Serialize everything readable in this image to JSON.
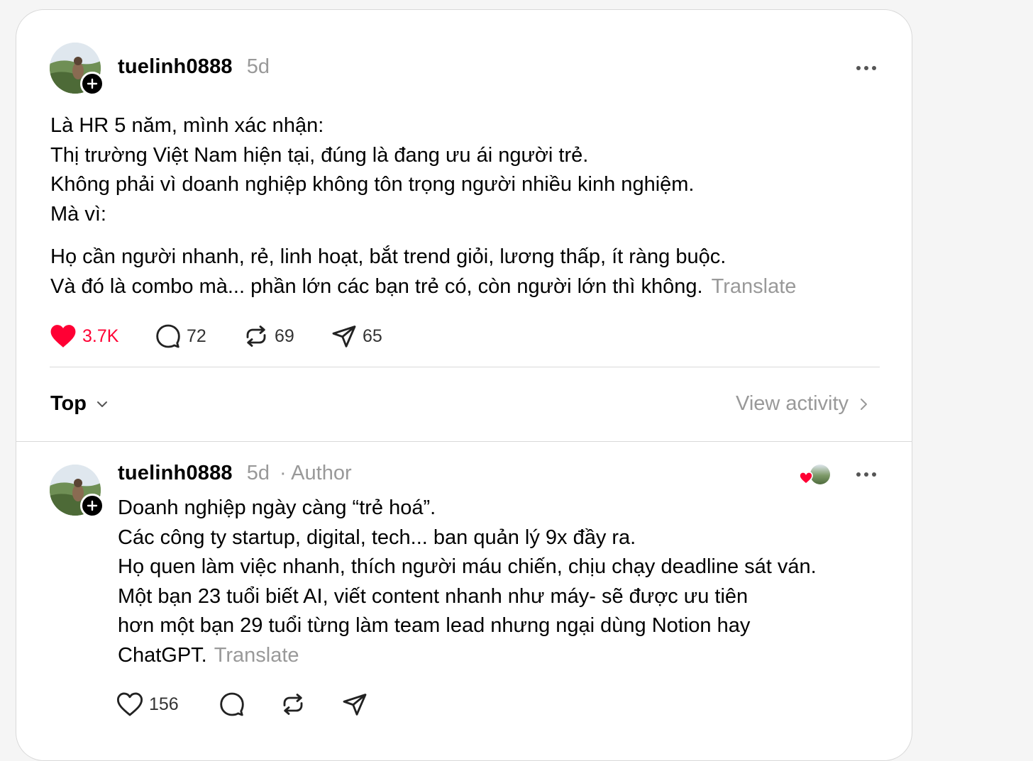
{
  "post": {
    "username": "tuelinh0888",
    "time": "5d",
    "lines": [
      "Là HR 5 năm, mình xác nhận:",
      "Thị trường Việt Nam hiện tại, đúng là đang ưu ái người trẻ.",
      "Không phải vì doanh nghiệp không tôn trọng người nhiều kinh nghiệm.",
      "Mà vì:",
      "Họ cần người nhanh, rẻ, linh hoạt, bắt trend giỏi, lương thấp, ít ràng buộc.",
      "Và đó là combo mà... phần lớn các bạn trẻ có, còn người lớn thì không."
    ],
    "translate": "Translate",
    "likes": "3.7K",
    "comments": "72",
    "reposts": "69",
    "shares": "65",
    "like_color": "#ff0034"
  },
  "sort": {
    "label": "Top",
    "view_activity": "View activity"
  },
  "reply": {
    "username": "tuelinh0888",
    "time": "5d",
    "separator": "·",
    "author_tag": "Author",
    "lines": [
      "Doanh nghiệp ngày càng “trẻ hoá”.",
      "Các công ty startup, digital, tech... ban quản lý 9x đầy ra.",
      "Họ quen làm việc nhanh, thích người máu chiến, chịu chạy deadline sát ván.",
      "Một bạn 23 tuổi biết AI, viết content nhanh như máy- sẽ được ưu tiên",
      "hơn một bạn 29 tuổi từng làm team lead nhưng ngại dùng Notion hay",
      "ChatGPT."
    ],
    "translate": "Translate",
    "likes": "156"
  }
}
